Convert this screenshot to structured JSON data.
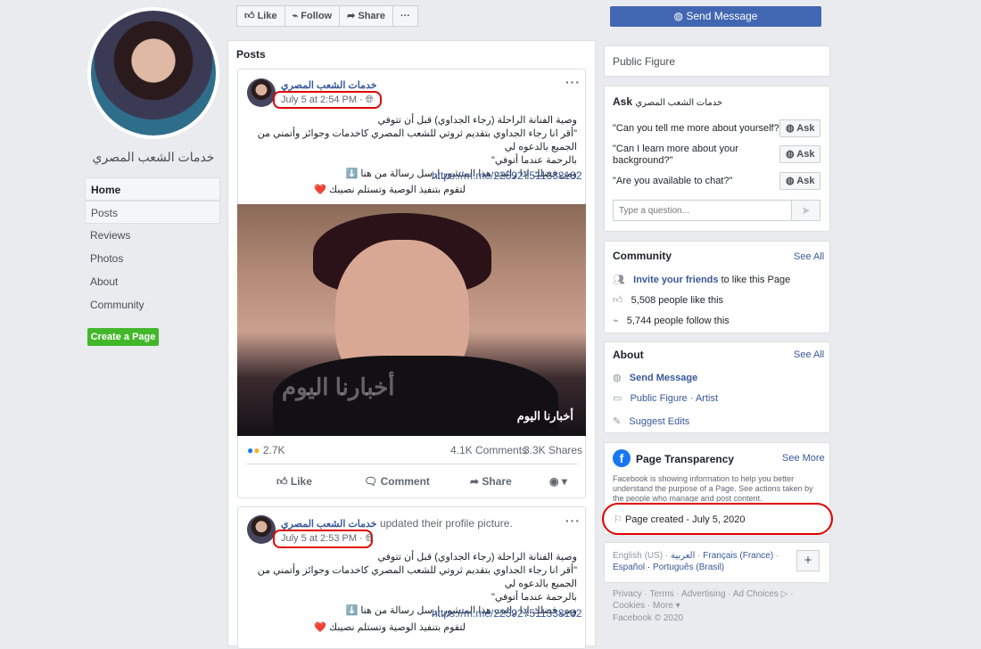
{
  "page": {
    "name": "خدمات الشعب المصري"
  },
  "nav": [
    {
      "label": "Home"
    },
    {
      "label": "Posts"
    },
    {
      "label": "Reviews"
    },
    {
      "label": "Photos"
    },
    {
      "label": "About"
    },
    {
      "label": "Community"
    }
  ],
  "create_page": "Create a Page",
  "actions": {
    "like": "Like",
    "follow": "Follow",
    "share": "Share",
    "more": "···",
    "send_message": "Send Message"
  },
  "posts_title": "Posts",
  "post1": {
    "author": "خدمات الشعب المصري",
    "time": "July 5 at 2:54 PM",
    "lines": [
      "وصية الفنانة الراحلة (رجاء الجداوي) قبل أن تتوفي",
      "\"أقر انا رجاء الجداوي بتقديم ثروتي للشعب المصري كاخدمات وجوائز وأتمني من الجميع بالدعوه لي",
      "بالرحمة عندما أتوفي\"",
      "ومن فضلك إذا رائيت هذا المنشور إرسل رسالة من هنا ⬇️"
    ],
    "url": "https://m.me/225927511338182",
    "last_line": "لتقوم بتنفيذ الوصية وتستلم نصيبك ❤️",
    "photo_watermark": "أخبارنا اليوم",
    "reactions": "2.7K",
    "comments": "4.1K Comments",
    "shares": "3.3K Shares",
    "like": "Like",
    "comment": "Comment",
    "share": "Share"
  },
  "post2": {
    "author": "خدمات الشعب المصري",
    "action": "updated their profile picture.",
    "time": "July 5 at 2:53 PM",
    "lines": [
      "وصية الفنانة الراحلة (رجاء الجداوي) قبل أن تتوفي",
      "\"أقر انا رجاء الجداوي بتقديم ثروتي للشعب المصري كاخدمات وجوائز وأتمني من الجميع بالدعوه لي",
      "بالرحمة عندما أتوفي\"",
      "ومن فضلك إذا رائيت هذا المنشور إرسل رسالة من هنا ⬇️"
    ],
    "url": "https://m.me/225927511338182",
    "last_line": "لتقوم بتنفيذ الوصية وتستلم نصيبك ❤️"
  },
  "right": {
    "category": "Public Figure",
    "ask": {
      "title": "Ask",
      "page": "خدمات الشعب المصري",
      "questions": [
        "\"Can you tell me more about yourself?\"",
        "\"Can I learn more about your background?\"",
        "\"Are you available to chat?\""
      ],
      "button": "Ask",
      "placeholder": "Type a question..."
    },
    "community": {
      "title": "Community",
      "see_all": "See All",
      "invite_link": "Invite your friends",
      "invite_rest": "to like this Page",
      "likes": "5,508 people like this",
      "follows": "5,744 people follow this"
    },
    "about": {
      "title": "About",
      "see_all": "See All",
      "send_message": "Send Message",
      "category": "Public Figure · Artist",
      "suggest": "Suggest Edits"
    },
    "transparency": {
      "title": "Page Transparency",
      "see_more": "See More",
      "desc": "Facebook is showing information to help you better understand the purpose of a Page. See actions taken by the people who manage and post content.",
      "created": "Page created - July 5, 2020"
    },
    "languages": {
      "line1a": "English (US)",
      "line1b": "العربية",
      "line1c": "Français (France)",
      "line2a": "Español",
      "line2b": "Português (Brasil)",
      "plus": "+"
    },
    "footer": {
      "line1": "Privacy · Terms · Advertising · Ad Choices ▷ ·",
      "line2": "Cookies · More ▾",
      "line3": "Facebook © 2020"
    }
  },
  "colors": {
    "brand": "#4267b2",
    "link": "#385898",
    "annotation": "#e00000",
    "create_btn": "#42b72a"
  }
}
